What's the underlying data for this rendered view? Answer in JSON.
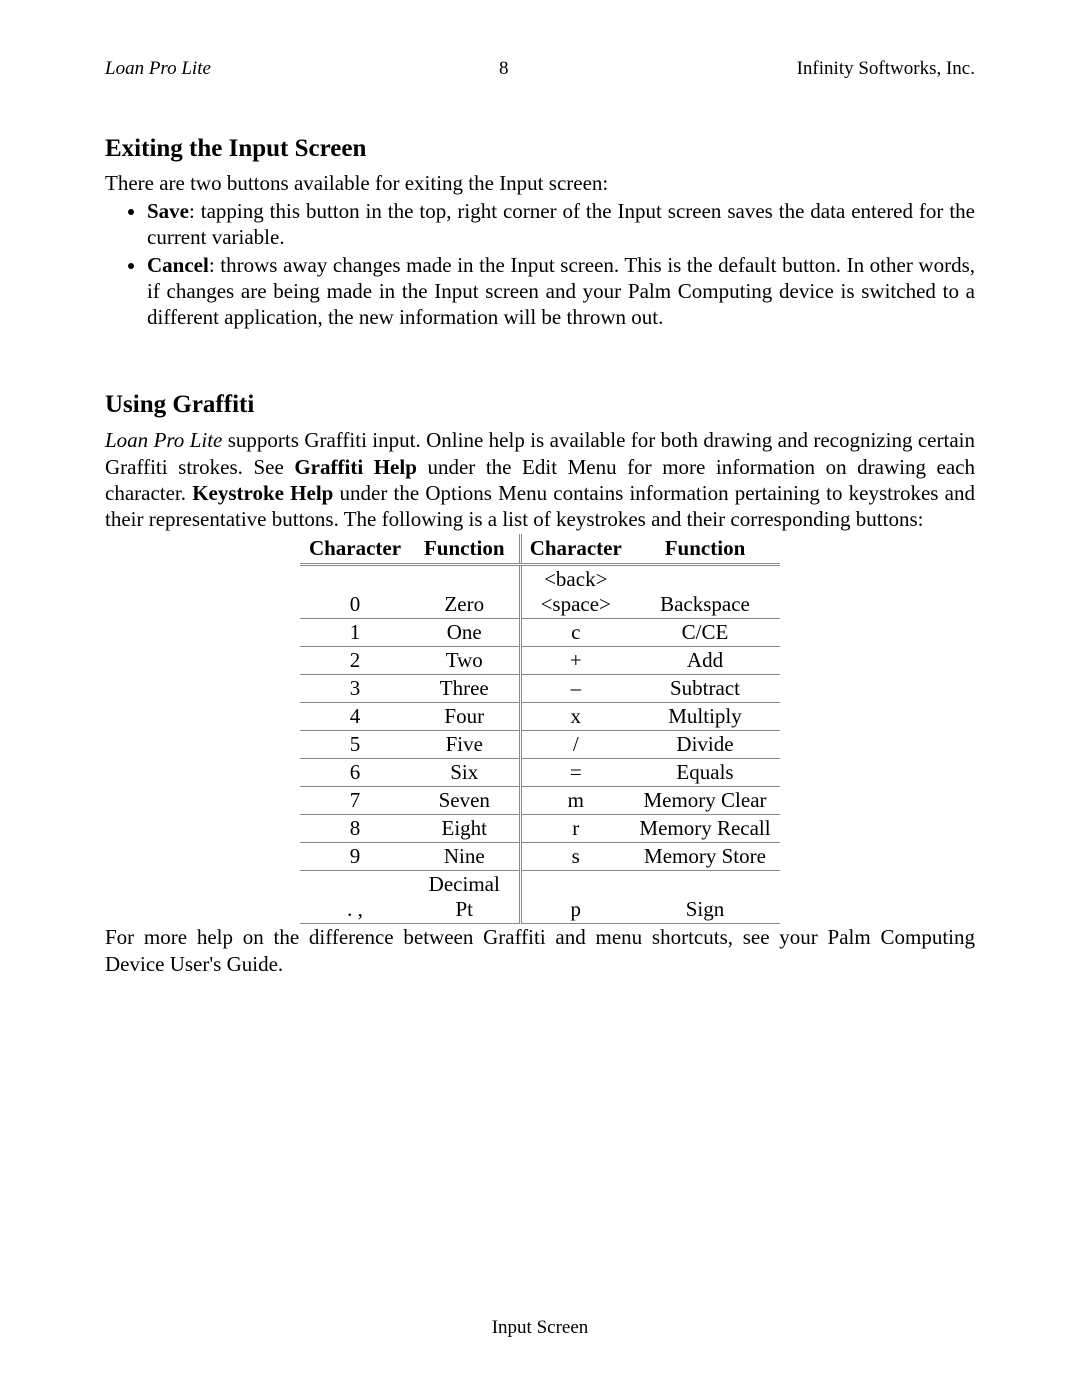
{
  "header": {
    "left": "Loan Pro Lite",
    "center": "8",
    "right": "Infinity Softworks, Inc."
  },
  "section1": {
    "heading": "Exiting the Input Screen",
    "intro": "There are two buttons available for exiting the Input screen:",
    "bullets": [
      {
        "bold": "Save",
        "text": ": tapping this button in the top, right corner of the Input screen saves the data entered for the current variable."
      },
      {
        "bold": "Cancel",
        "text": ": throws away changes made in the Input screen.  This is the default button.  In other words, if changes are being made in the Input screen and your Palm Computing device is switched to a different application, the new information will be thrown out."
      }
    ]
  },
  "section2": {
    "heading": "Using Graffiti",
    "para_parts": {
      "p1_italic": "Loan Pro Lite",
      "p1_a": " supports Graffiti input.  Online help is available for both drawing and recognizing certain Graffiti strokes.  See ",
      "p1_bold1": "Graffiti Help",
      "p1_b": " under the Edit Menu for more information on drawing each character.  ",
      "p1_bold2": "Keystroke Help",
      "p1_c": " under the Options Menu contains information pertaining to keystrokes and their representative buttons.  The following is a list of keystrokes and their corresponding buttons:"
    },
    "table_headers": {
      "char_a": "Character",
      "func_a": "Function",
      "char_b": "Character",
      "func_b": "Function"
    },
    "rows": [
      {
        "ca": "0",
        "fa": "Zero",
        "cb": "<back> <space>",
        "fb": "Backspace"
      },
      {
        "ca": "1",
        "fa": "One",
        "cb": "c",
        "fb": "C/CE"
      },
      {
        "ca": "2",
        "fa": "Two",
        "cb": "+",
        "fb": "Add"
      },
      {
        "ca": "3",
        "fa": "Three",
        "cb": "–",
        "fb": "Subtract"
      },
      {
        "ca": "4",
        "fa": "Four",
        "cb": "x",
        "fb": "Multiply"
      },
      {
        "ca": "5",
        "fa": "Five",
        "cb": "/",
        "fb": "Divide"
      },
      {
        "ca": "6",
        "fa": "Six",
        "cb": "=",
        "fb": "Equals"
      },
      {
        "ca": "7",
        "fa": "Seven",
        "cb": "m",
        "fb": "Memory Clear"
      },
      {
        "ca": "8",
        "fa": "Eight",
        "cb": "r",
        "fb": "Memory Recall"
      },
      {
        "ca": "9",
        "fa": "Nine",
        "cb": "s",
        "fb": "Memory Store"
      },
      {
        "ca": ".  ,",
        "fa": "Decimal Pt",
        "cb": "p",
        "fb": "Sign"
      }
    ],
    "after": "For more help on the difference between Graffiti and menu shortcuts, see your Palm Computing Device User's Guide."
  },
  "footer": "Input Screen"
}
